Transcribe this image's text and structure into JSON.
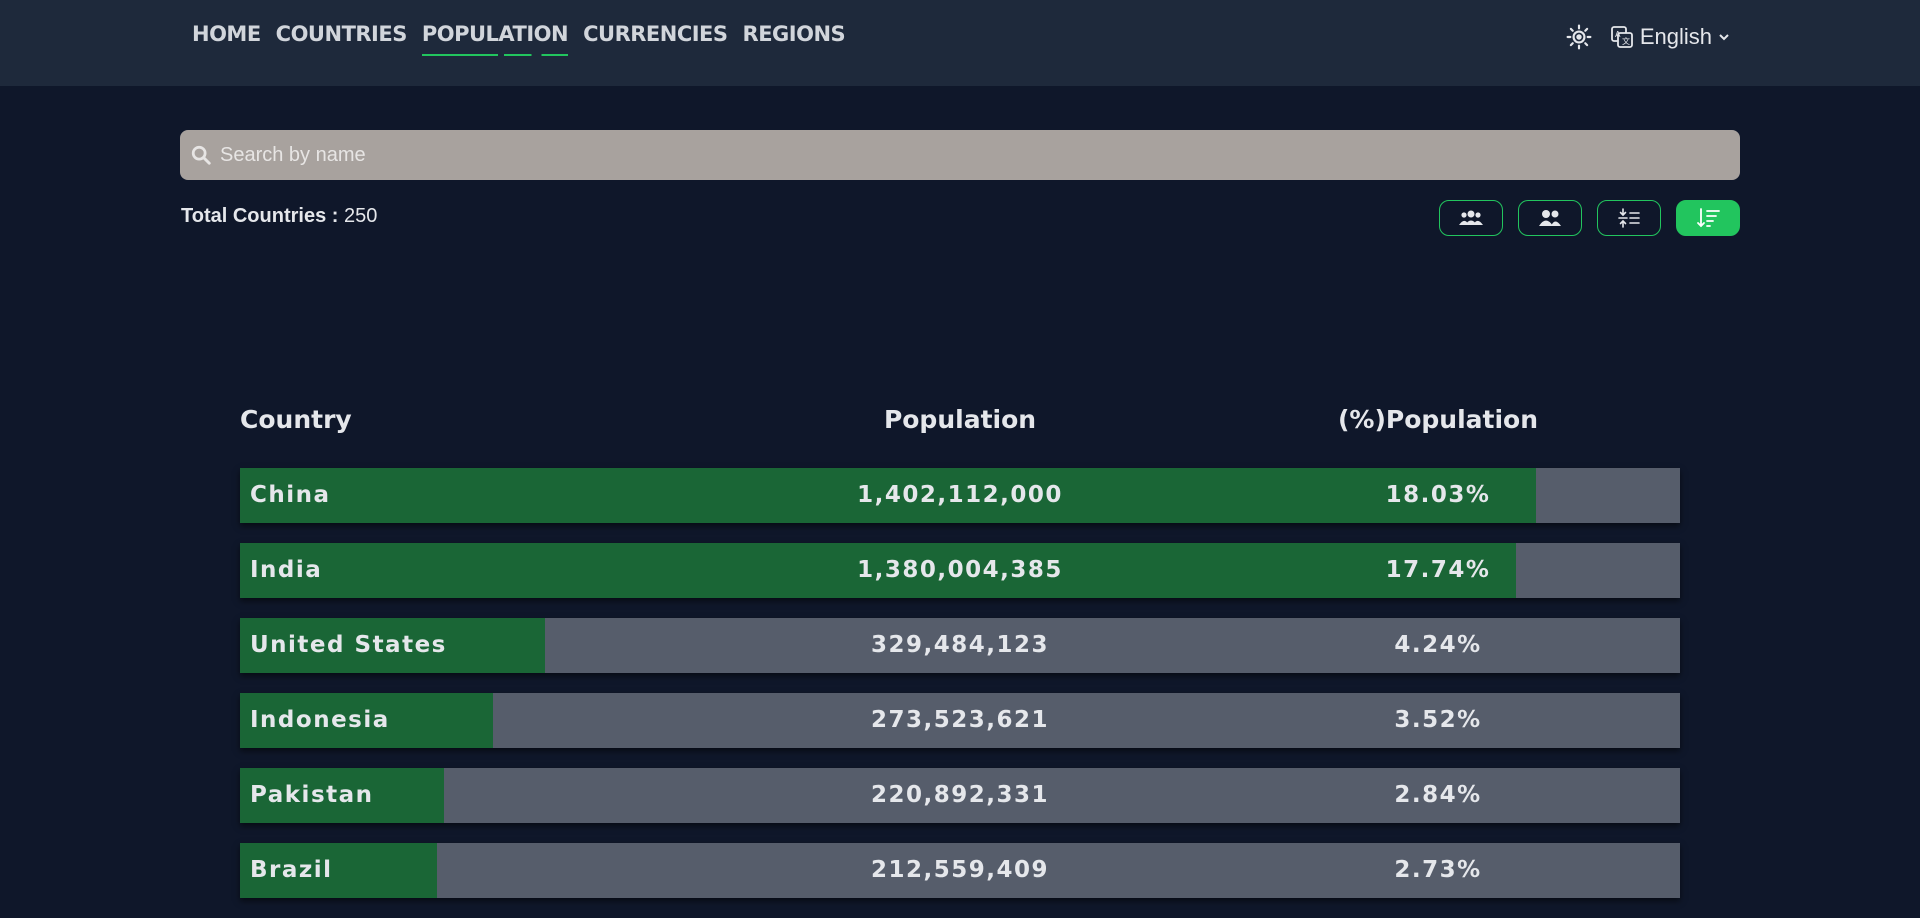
{
  "nav": {
    "items": [
      {
        "label": "HOME",
        "active": false
      },
      {
        "label": "COUNTRIES",
        "active": false
      },
      {
        "label": "POPULATION",
        "active": true
      },
      {
        "label": "CURRENCIES",
        "active": false
      },
      {
        "label": "REGIONS",
        "active": false
      }
    ],
    "language": "English",
    "icons": [
      "sun-icon",
      "translate-icon",
      "chevron-down-icon"
    ]
  },
  "search": {
    "placeholder": "Search by name",
    "value": ""
  },
  "summary": {
    "label": "Total Countries :",
    "value": "250"
  },
  "sort_buttons": [
    {
      "icon": "users-group-icon",
      "active": false
    },
    {
      "icon": "users-icon",
      "active": false
    },
    {
      "icon": "sort-ascending-icon",
      "active": false
    },
    {
      "icon": "sort-descending-icon",
      "active": true
    }
  ],
  "colors": {
    "accent": "#22c55e",
    "bar": "#1a6636",
    "row_bg": "#565d6b",
    "page_bg": "#0f172a",
    "header_bg": "#1e293b"
  },
  "table": {
    "headers": {
      "country": "Country",
      "population": "Population",
      "percent": "(%)Population"
    },
    "rows": [
      {
        "country": "China",
        "population": "1,402,112,000",
        "percent": "18.03%",
        "share": 0.9
      },
      {
        "country": "India",
        "population": "1,380,004,385",
        "percent": "17.74%",
        "share": 0.886
      },
      {
        "country": "United States",
        "population": "329,484,123",
        "percent": "4.24%",
        "share": 0.212
      },
      {
        "country": "Indonesia",
        "population": "273,523,621",
        "percent": "3.52%",
        "share": 0.176
      },
      {
        "country": "Pakistan",
        "population": "220,892,331",
        "percent": "2.84%",
        "share": 0.142
      },
      {
        "country": "Brazil",
        "population": "212,559,409",
        "percent": "2.73%",
        "share": 0.137
      }
    ]
  }
}
